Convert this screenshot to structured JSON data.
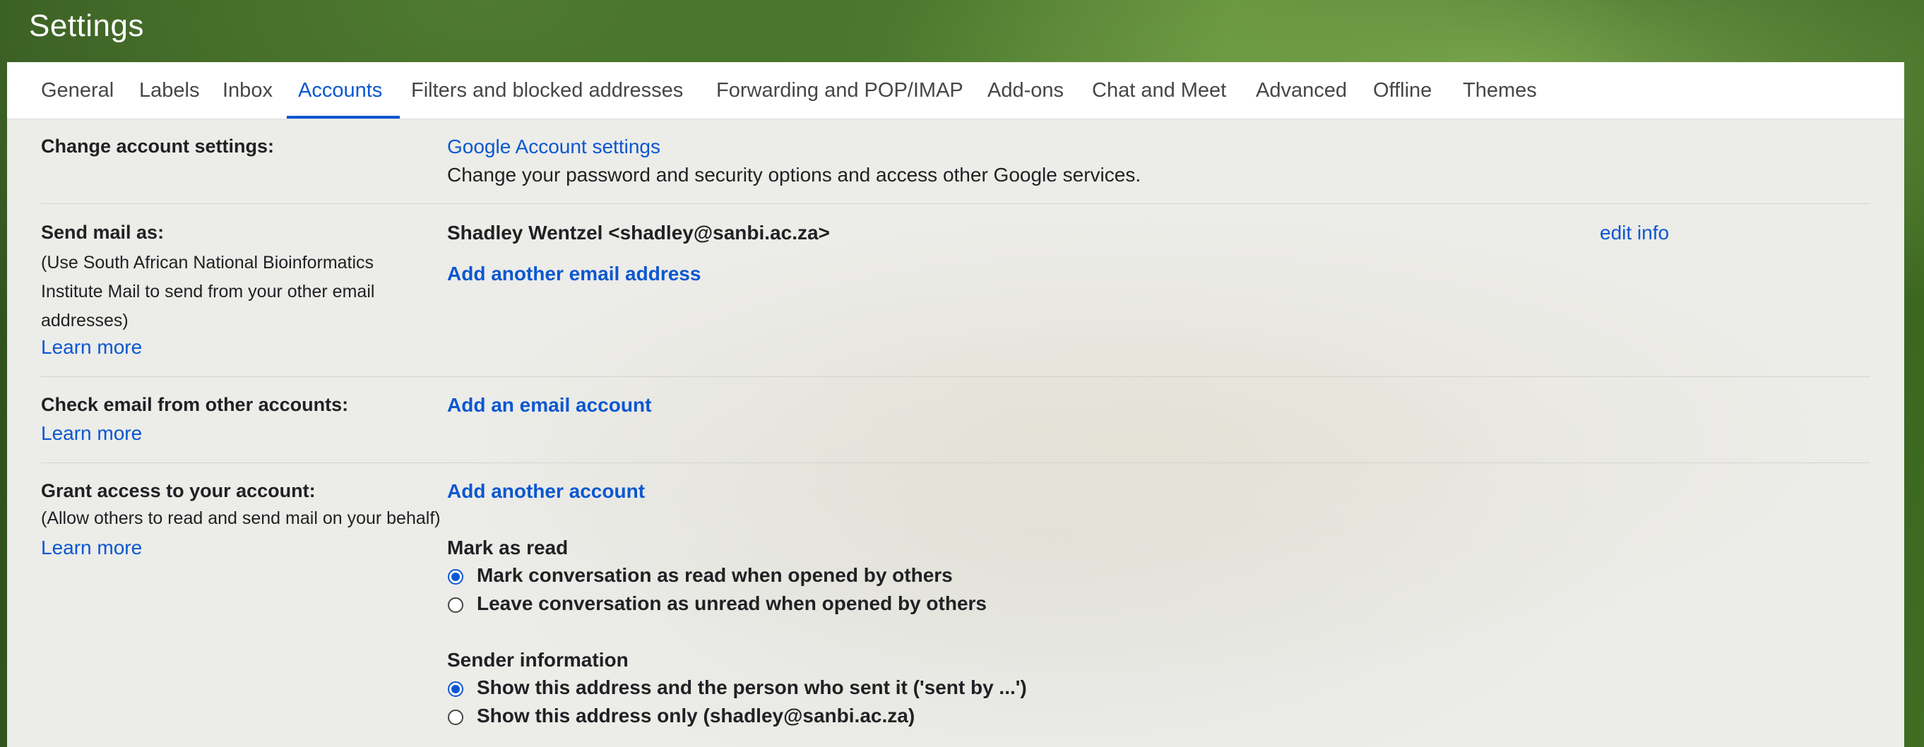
{
  "header": {
    "title": "Settings"
  },
  "tabs": [
    {
      "label": "General"
    },
    {
      "label": "Labels"
    },
    {
      "label": "Inbox"
    },
    {
      "label": "Accounts",
      "active": true
    },
    {
      "label": "Filters and blocked addresses"
    },
    {
      "label": "Forwarding and POP/IMAP"
    },
    {
      "label": "Add-ons"
    },
    {
      "label": "Chat and Meet"
    },
    {
      "label": "Advanced"
    },
    {
      "label": "Offline"
    },
    {
      "label": "Themes"
    }
  ],
  "change_account": {
    "label": "Change account settings:",
    "link": "Google Account settings",
    "description": "Change your password and security options and access other Google services."
  },
  "send_mail_as": {
    "label": "Send mail as:",
    "sub_line1": "(Use South African National Bioinformatics",
    "sub_line2": "Institute Mail to send from your other email",
    "sub_line3": "addresses)",
    "learn_more": "Learn more",
    "address": "Shadley Wentzel <shadley@sanbi.ac.za>",
    "edit_info": "edit info",
    "add_address": "Add another email address"
  },
  "check_email": {
    "label": "Check email from other accounts:",
    "learn_more": "Learn more",
    "add_account": "Add an email account"
  },
  "grant_access": {
    "label": "Grant access to your account:",
    "sub": "(Allow others to read and send mail on your behalf)",
    "learn_more": "Learn more",
    "add_account": "Add another account",
    "mark_as_read": {
      "heading": "Mark as read",
      "option1": "Mark conversation as read when opened by others",
      "option2": "Leave conversation as unread when opened by others",
      "selected": 1
    },
    "sender_info": {
      "heading": "Sender information",
      "option1": "Show this address and the person who sent it ('sent by ...')",
      "option2": "Show this address only (shadley@sanbi.ac.za)",
      "selected": 1
    }
  },
  "colors": {
    "accent": "#0b57d0",
    "text": "#202124",
    "tab_text": "#444746"
  }
}
